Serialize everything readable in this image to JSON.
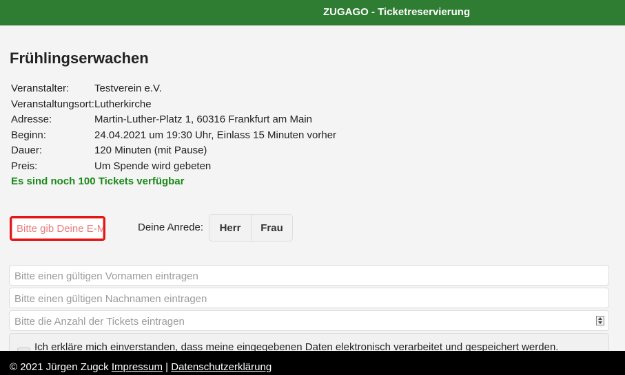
{
  "header": {
    "brand": "ZUGAGO - Ticketreservierung"
  },
  "event": {
    "title": "Frühlingserwachen",
    "rows": [
      {
        "label": "Veranstalter:",
        "value": "Testverein e.V."
      },
      {
        "label": "Veranstaltungsort:",
        "value": "Lutherkirche"
      },
      {
        "label": "Adresse:",
        "value": "Martin-Luther-Platz 1, 60316 Frankfurt am Main"
      },
      {
        "label": "Beginn:",
        "value": "24.04.2021 um 19:30 Uhr, Einlass 15 Minuten vorher"
      },
      {
        "label": "Dauer:",
        "value": "120 Minuten (mit Pause)"
      },
      {
        "label": "Preis:",
        "value": "Um Spende wird gebeten"
      }
    ],
    "availability": "Es sind noch 100 Tickets verfügbar"
  },
  "form": {
    "email_placeholder": "Bitte gib Deine E-Mail-Adresse ein",
    "salutation_label": "Deine Anrede:",
    "salutation_options": [
      "Herr",
      "Frau"
    ],
    "firstname_placeholder": "Bitte einen gültigen Vornamen eintragen",
    "lastname_placeholder": "Bitte einen gültigen Nachnamen eintragen",
    "tickets_placeholder": "Bitte die Anzahl der Tickets eintragen",
    "consent_text": "Ich erkläre mich einverstanden, dass meine eingegebenen Daten elektronisch verarbeitet und gespeichert werden."
  },
  "footer": {
    "copyright": "© 2021 Jürgen Zugck",
    "impressum": "Impressum",
    "separator": "|",
    "privacy": "Datenschutzerklärung"
  },
  "colors": {
    "header_bg": "#2e7d32",
    "availability": "#1a8a1a",
    "email_border": "#e01818",
    "footer_bg": "#000000"
  }
}
